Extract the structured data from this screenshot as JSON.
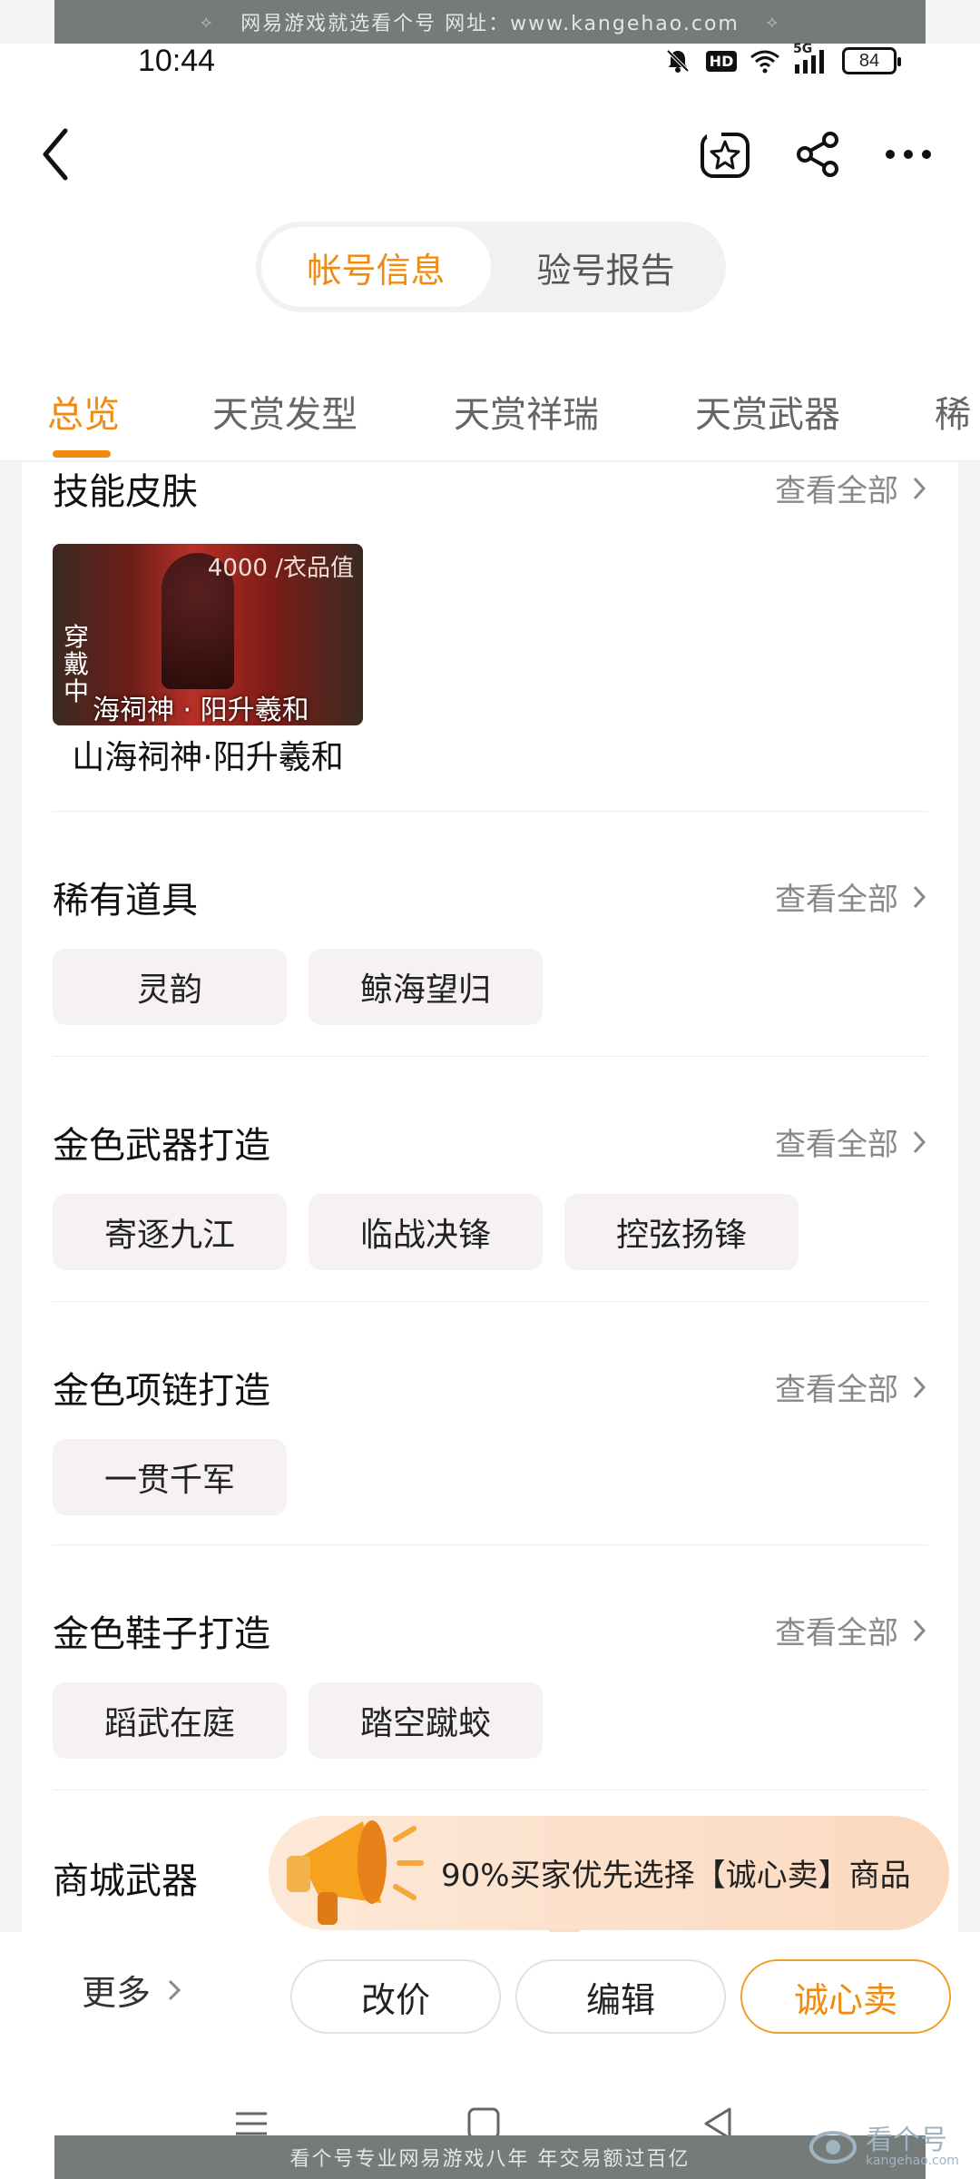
{
  "watermark": {
    "top_text": "网易游戏就选看个号    网址：www.kangehao.com",
    "bottom_text": "看个号专业网易游戏八年    年交易额过百亿",
    "logo_text": "看个号",
    "logo_sub": "kangehao.com"
  },
  "status_bar": {
    "time": "10:44",
    "network": "5G",
    "hd": "HD",
    "battery": "84"
  },
  "header": {
    "icons": [
      "back-arrow-icon",
      "favorite-star-icon",
      "share-icon",
      "more-dots-icon"
    ]
  },
  "segment": {
    "items": [
      {
        "label": "帐号信息",
        "active": true
      },
      {
        "label": "验号报告",
        "active": false
      }
    ]
  },
  "tabs": {
    "items": [
      "总览",
      "天赏发型",
      "天赏祥瑞",
      "天赏武器",
      "稀"
    ],
    "active_index": 0
  },
  "sections": {
    "view_all": "查看全部",
    "skill_skin": {
      "title": "技能皮肤",
      "item_name": "山海祠神·阳升羲和",
      "image_value": "4000 /衣品值",
      "image_badge": "穿戴中",
      "image_banner": "海祠神 · 阳升羲和"
    },
    "rare_items": {
      "title": "稀有道具",
      "chips": [
        "灵韵",
        "鲸海望归"
      ]
    },
    "gold_weapon": {
      "title": "金色武器打造",
      "chips": [
        "寄逐九江",
        "临战决锋",
        "控弦扬锋"
      ]
    },
    "gold_necklace": {
      "title": "金色项链打造",
      "chips": [
        "一贯千军"
      ]
    },
    "gold_shoes": {
      "title": "金色鞋子打造",
      "chips": [
        "蹈武在庭",
        "踏空蹴蛟"
      ]
    },
    "mall_weapon": {
      "title": "商城武器"
    }
  },
  "promo": {
    "text": "90%买家优先选择【诚心卖】商品"
  },
  "bottom_bar": {
    "more": "更多",
    "buttons": [
      "改价",
      "编辑",
      "诚心卖"
    ]
  },
  "colors": {
    "accent": "#f08a10",
    "chip_bg": "#f6f2f4",
    "promo_bg": "#fbd9bf"
  }
}
